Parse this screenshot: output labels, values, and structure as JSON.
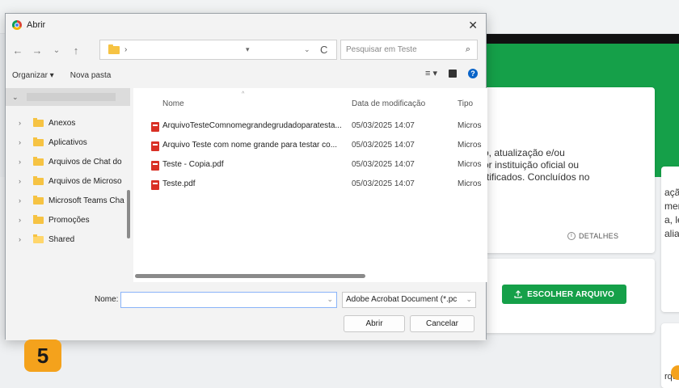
{
  "dialog": {
    "title": "Abrir",
    "close_icon": "close-icon",
    "nav": {
      "back": "←",
      "forward": "→",
      "recent": "⌄",
      "up": "↑",
      "address_sep": "›",
      "refresh": "C"
    },
    "search_placeholder": "Pesquisar em Teste",
    "commands": {
      "organize": "Organizar ▾",
      "new_folder": "Nova pasta"
    },
    "sidebar": [
      {
        "label": "Anexos"
      },
      {
        "label": "Aplicativos"
      },
      {
        "label": "Arquivos de Chat do"
      },
      {
        "label": "Arquivos de Microso"
      },
      {
        "label": "Microsoft Teams Cha"
      },
      {
        "label": "Promoções"
      },
      {
        "label": "Shared"
      }
    ],
    "columns": {
      "name": "Nome",
      "date": "Data de modificação",
      "type": "Tipo"
    },
    "files": [
      {
        "name": "ArquivoTesteComnomegrandegrudadoparatesta...",
        "date": "05/03/2025 14:07",
        "type": "Micros"
      },
      {
        "name": "Arquivo Teste com nome grande para testar co...",
        "date": "05/03/2025 14:07",
        "type": "Micros"
      },
      {
        "name": "Teste - Copia.pdf",
        "date": "05/03/2025 14:07",
        "type": "Micros"
      },
      {
        "name": "Teste.pdf",
        "date": "05/03/2025 14:07",
        "type": "Micros"
      }
    ],
    "filename_label": "Nome:",
    "filename_value": "",
    "filetype": "Adobe Acrobat Document (*.pc",
    "open_button": "Abrir",
    "cancel_button": "Cancelar"
  },
  "page": {
    "card_text": [
      "o, atualização e/ou",
      "or instituição oficial ou",
      "rtificados. Concluídos no"
    ],
    "details_link": "DETALHES",
    "upload_button": "ESCOLHER ARQUIVO",
    "right_text": [
      "ação",
      "mer",
      "a, le",
      "aliat"
    ],
    "right_bottom": "rqu"
  },
  "step_badge": "5",
  "colors": {
    "accent_green": "#15a049",
    "badge_orange": "#f4a21c",
    "pdf_red": "#d93025",
    "folder_yellow": "#f6c343"
  }
}
